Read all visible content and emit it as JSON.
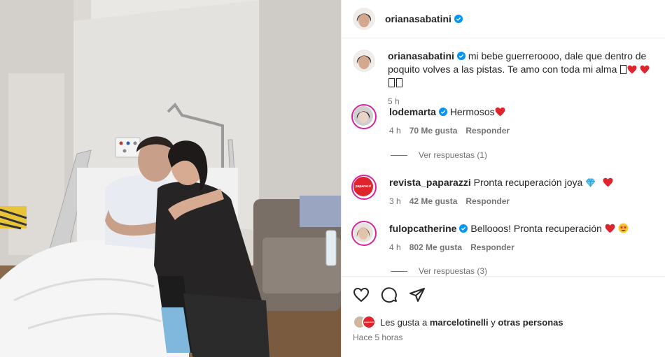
{
  "post": {
    "author": "orianasabatini",
    "caption": "mi bebe guerreroooo, dale que dentro de poquito volves a las pistas. Te amo con toda mi alma",
    "caption_time": "5 h"
  },
  "comments": [
    {
      "username": "lodemarta",
      "text": "Hermosos",
      "time": "4 h",
      "likes": "70 Me gusta",
      "reply_label": "Responder",
      "view_replies": "Ver respuestas (1)"
    },
    {
      "username": "revista_paparazzi",
      "text": "Pronta recuperación joya",
      "time": "3 h",
      "likes": "42 Me gusta",
      "reply_label": "Responder",
      "avatar_text": "paparazzi"
    },
    {
      "username": "fulopcatherine",
      "text": "Bellooos! Pronta recuperación",
      "time": "4 h",
      "likes": "802 Me gusta",
      "reply_label": "Responder",
      "view_replies": "Ver respuestas (3)"
    }
  ],
  "likes_summary": {
    "prefix": "Les gusta a",
    "user": "marcelotinelli",
    "connector": "y",
    "others": "otras personas",
    "mini_avatar_text": "paparazzi"
  },
  "post_time": "Hace 5 horas",
  "icons": [
    "heart-icon",
    "comment-icon",
    "share-icon",
    "verified-badge-icon"
  ],
  "colors": {
    "verified": "#0095f6",
    "heart_red": "#ff3040",
    "muted": "#737373",
    "story_ring": "#d6249f"
  }
}
